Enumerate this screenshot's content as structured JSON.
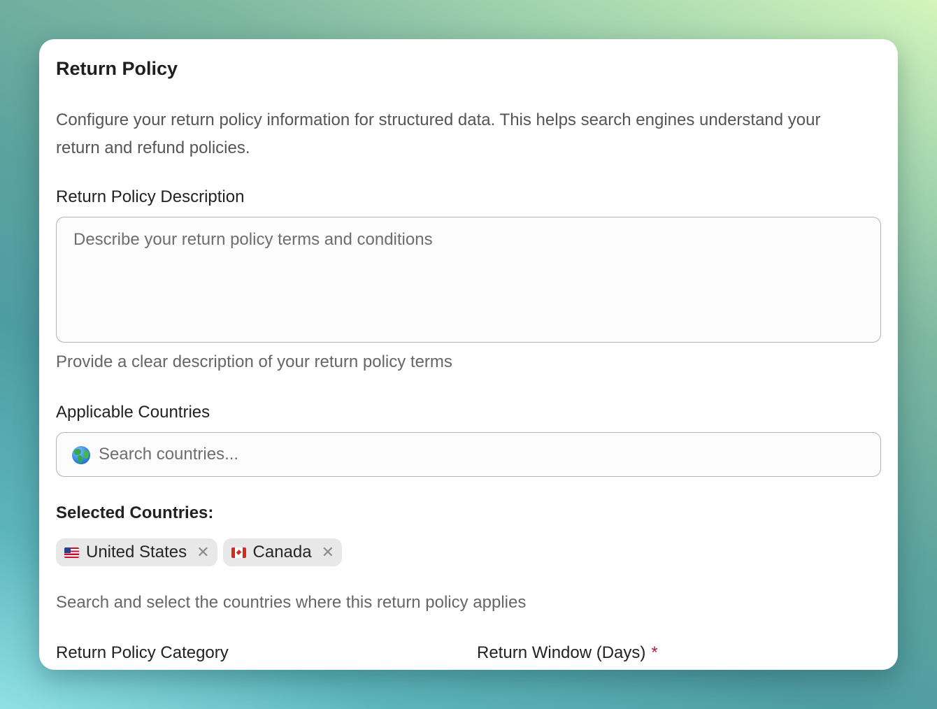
{
  "card": {
    "title": "Return Policy",
    "intro": "Configure your return policy information for structured data. This helps search engines understand your return and refund policies."
  },
  "description_field": {
    "label": "Return Policy Description",
    "placeholder": "Describe your return policy terms and conditions",
    "value": "",
    "help": "Provide a clear description of your return policy terms"
  },
  "countries_field": {
    "label": "Applicable Countries",
    "search_icon": "globe-icon",
    "placeholder": "Search countries...",
    "selected_label": "Selected Countries:",
    "selected": [
      {
        "label": "United States",
        "flag": "us-flag-icon",
        "remove_icon": "close-icon"
      },
      {
        "label": "Canada",
        "flag": "ca-flag-icon",
        "remove_icon": "close-icon"
      }
    ],
    "remove_glyph": "✕",
    "help": "Search and select the countries where this return policy applies"
  },
  "category_field": {
    "label": "Return Policy Category"
  },
  "window_field": {
    "label": "Return Window (Days)",
    "required_mark": "*"
  },
  "colors": {
    "required": "#b0243a",
    "chip_background": "#e8e8e8",
    "card_background": "#ffffff"
  }
}
